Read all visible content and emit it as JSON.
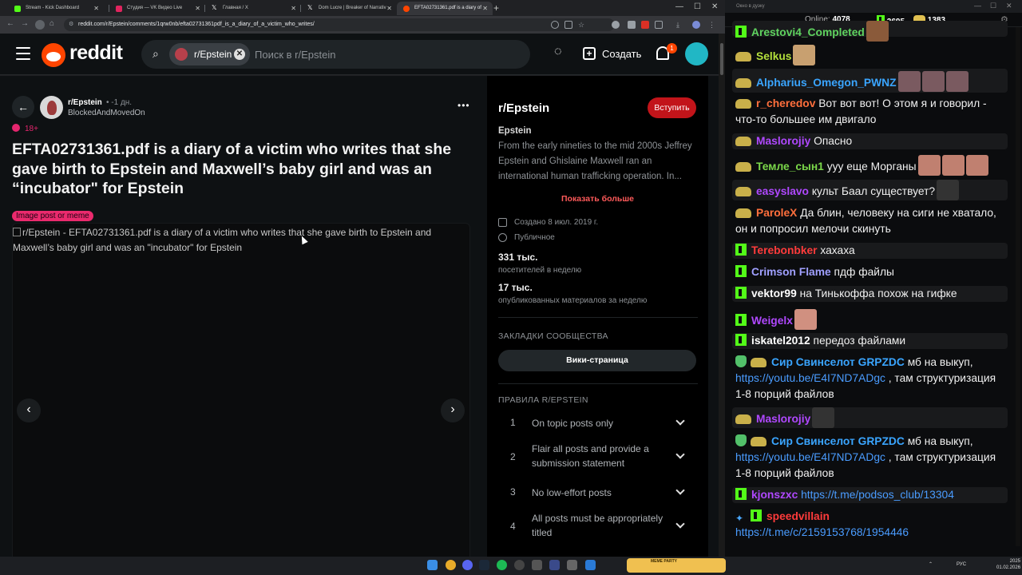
{
  "browser": {
    "tabs": [
      {
        "title": "Stream - Kick Dashboard",
        "color": "#53fc18"
      },
      {
        "title": "Студия — VK Видео Live",
        "color": "#e0245e"
      },
      {
        "title": "Главная / X",
        "color": "#ffffff"
      },
      {
        "title": "Dom Lucre | Breaker of Narrativ",
        "color": "#ffffff"
      },
      {
        "title": "EFTA02731361.pdf is a diary of",
        "color": "#ff4500"
      }
    ],
    "url": "reddit.com/r/Epstein/comments/1qrw0nb/efta02731361pdf_is_a_diary_of_a_victim_who_writes/"
  },
  "header": {
    "logo_text": "reddit",
    "search_chip": "r/Epstein",
    "search_placeholder": "Поиск в r/Epstein",
    "create_label": "Создать",
    "notif_count": "1"
  },
  "post": {
    "subreddit": "r/Epstein",
    "time": "• -1 дн.",
    "author": "BlockedAndMovedOn",
    "nsfw": "18+",
    "title": "EFTA02731361.pdf is a diary of a victim who writes that she gave birth to Epstein and Maxwell’s baby girl and was an “incubator\" for Epstein",
    "flair": "Image post or meme",
    "image_alt": "r/Epstein - EFTA02731361.pdf is a diary of a victim who writes that she gave birth to Epstein and Maxwell’s baby girl and was an \"incubator\" for Epstein"
  },
  "sidebar": {
    "title": "r/Epstein",
    "join_label": "Вступить",
    "name": "Epstein",
    "description": "From the early nineties to the mid 2000s Jeffrey Epstein and Ghislaine Maxwell ran an international human trafficking operation. In...",
    "show_more": "Показать больше",
    "created": "Создано 8 июл. 2019 г.",
    "visibility": "Публичное",
    "visitors": "331 тыс.",
    "visitors_label": "посетителей в неделю",
    "contributions": "17 тыс.",
    "contributions_label": "опубликованных материалов за неделю",
    "bookmarks_heading": "ЗАКЛАДКИ СООБЩЕСТВА",
    "wiki_label": "Вики-страница",
    "rules_heading": "ПРАВИЛА R/EPSTEIN",
    "rules": [
      {
        "num": "1",
        "text": "On topic posts only"
      },
      {
        "num": "2",
        "text": "Flair all posts and provide a submission statement"
      },
      {
        "num": "3",
        "text": "No low-effort posts"
      },
      {
        "num": "4",
        "text": "All posts must be appropriately titled"
      }
    ]
  },
  "chat": {
    "window_title": "Окно в дуэку",
    "online_label": "Online:",
    "online_count": "4078",
    "kick_count": "2695",
    "eye_count": "1383",
    "messages": [
      {
        "user": "Arestovi4_Completed",
        "text": "",
        "user_color": "#5fd35f"
      },
      {
        "user": "Selkus",
        "text": "",
        "user_color": "#b4e03c"
      },
      {
        "user": "Alpharius_Omegon_PWNZ",
        "text": "",
        "user_color": "#3aa5ff"
      },
      {
        "user": "r_cheredov",
        "text": "Вот вот вот! О этом я и говорил - что-то большее им двигало",
        "user_color": "#ff6f3c"
      },
      {
        "user": "Maslorojiy",
        "text": "Опасно",
        "user_color": "#b048ff"
      },
      {
        "user": "Темле_сын1",
        "text": "ууу еще Морганы",
        "user_color": "#7bd84a"
      },
      {
        "user": "easyslavo",
        "text": "культ Баал существует?",
        "user_color": "#b048ff"
      },
      {
        "user": "ParoleX",
        "text": "Да блин, человеку на сиги не хватало, он и попросил мелочи скинуть",
        "user_color": "#ff6f3c"
      },
      {
        "user": "Terebonbker",
        "text": "хахаха",
        "user_color": "#ff3b3b"
      },
      {
        "user": "Crimson Flame",
        "text": "пдф файлы",
        "user_color": "#a0a0ff"
      },
      {
        "user": "vektor99",
        "text": "на Тинькоффа похож на гифке",
        "user_color": "#ffffff"
      },
      {
        "user": "Weigelx",
        "text": "",
        "user_color": "#b048ff"
      },
      {
        "user": "iskatel2012",
        "text": "передоз файлами",
        "user_color": "#ffffff"
      },
      {
        "user": "Сир Свинселот",
        "mention": "GRPZDC",
        "link": "https://youtu.be/E4I7ND7ADgc",
        "text": ", там структуризация 1-8 порций файлов",
        "pre": "мб на выкуп,",
        "user_color": "#3aa5ff"
      },
      {
        "user": "Maslorojiy",
        "text": "",
        "user_color": "#b048ff"
      },
      {
        "user": "Сир Свинселот",
        "mention": "GRPZDC",
        "link": "https://youtu.be/E4I7ND7ADgc",
        "text": ", там структуризация 1-8 порций файлов",
        "pre": "мб на выкуп,",
        "user_color": "#3aa5ff"
      },
      {
        "user": "kjonszxc",
        "link": "https://t.me/podsos_club/13304",
        "user_color": "#b048ff"
      },
      {
        "user": "speedvillain",
        "link": "https://t.me/c/2159153768/1954446",
        "user_color": "#ff3b3b"
      }
    ]
  },
  "taskbar": {
    "lang": "РУС",
    "time": "2025",
    "date": "01.02.2026",
    "meme_party": "MEME PARTY"
  }
}
